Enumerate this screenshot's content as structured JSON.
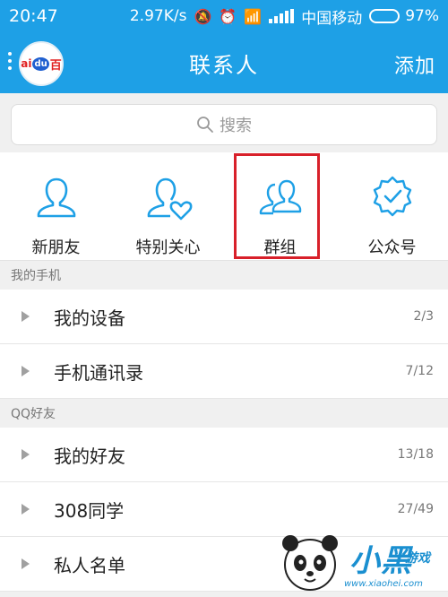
{
  "status": {
    "time": "20:47",
    "speed": "2.97K/s",
    "carrier": "中国移动",
    "battery": "97%",
    "battery_level": 0.97
  },
  "appbar": {
    "title": "联系人",
    "add_label": "添加",
    "avatar_text_left": "ai",
    "avatar_text_mid": "du",
    "avatar_text_right": "百"
  },
  "search": {
    "placeholder": "搜索"
  },
  "shortcuts": [
    {
      "label": "新朋友",
      "icon": "person-icon"
    },
    {
      "label": "特别关心",
      "icon": "person-heart-icon"
    },
    {
      "label": "群组",
      "icon": "group-icon"
    },
    {
      "label": "公众号",
      "icon": "badge-check-icon"
    }
  ],
  "sections": [
    {
      "header": "我的手机",
      "rows": [
        {
          "name": "我的设备",
          "count": "2/3"
        },
        {
          "name": "手机通讯录",
          "count": "7/12"
        }
      ]
    },
    {
      "header": "QQ好友",
      "rows": [
        {
          "name": "我的好友",
          "count": "13/18"
        },
        {
          "name": "308同学",
          "count": "27/49"
        },
        {
          "name": "私人名单",
          "count": ""
        }
      ]
    }
  ],
  "watermark": {
    "brand": "小黑",
    "brand_suffix": "游戏",
    "url": "www.xiaohei.com"
  },
  "colors": {
    "accent": "#1ea0e6",
    "icon_stroke": "#1ea0e6",
    "highlight": "#d8202a"
  }
}
